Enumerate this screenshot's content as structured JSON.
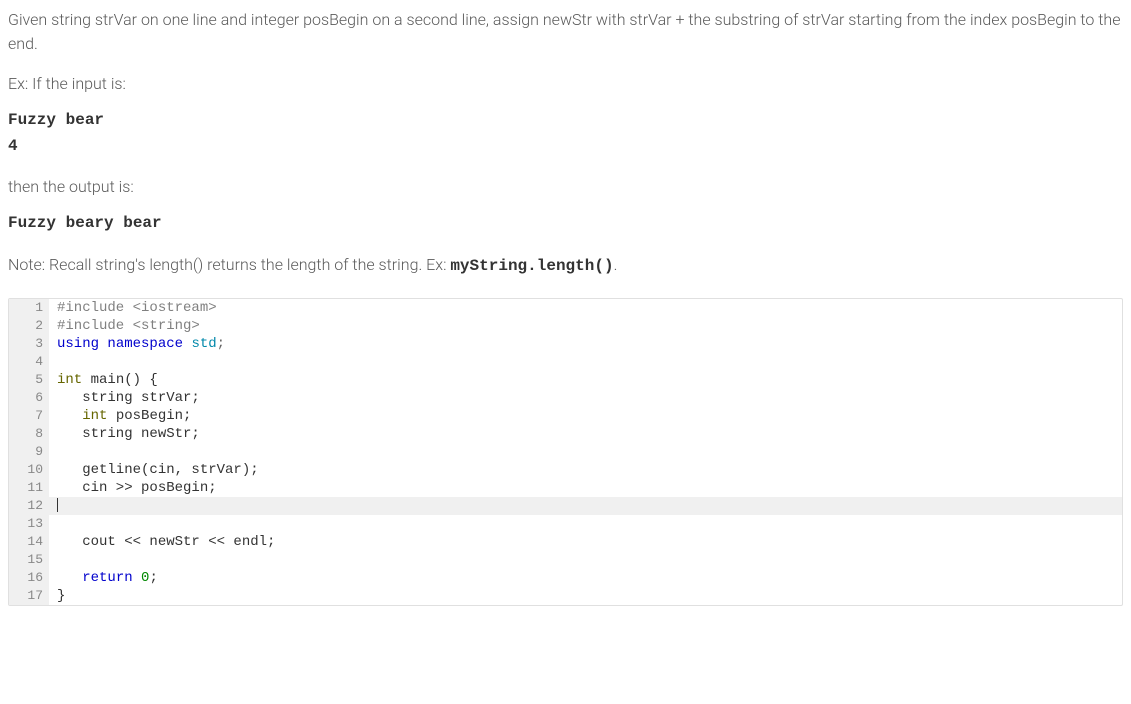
{
  "problem": {
    "description": "Given string strVar on one line and integer posBegin on a second line, assign newStr with strVar + the substring of strVar starting from the index posBegin to the end.",
    "example_intro": "Ex: If the input is:",
    "example_input": "Fuzzy bear\n4",
    "then_label": "then the output is:",
    "example_output": "Fuzzy beary bear",
    "note_prefix": "Note: Recall string's length() returns the length of the string. Ex: ",
    "note_code": "myString.length()",
    "note_suffix": "."
  },
  "code": {
    "lines": [
      {
        "n": "1",
        "tokens": [
          {
            "t": "#include <iostream>",
            "c": "tok-pp"
          }
        ],
        "editable": false
      },
      {
        "n": "2",
        "tokens": [
          {
            "t": "#include <string>",
            "c": "tok-pp"
          }
        ],
        "editable": false
      },
      {
        "n": "3",
        "tokens": [
          {
            "t": "using",
            "c": "tok-kw"
          },
          {
            "t": " ",
            "c": ""
          },
          {
            "t": "namespace",
            "c": "tok-kw"
          },
          {
            "t": " ",
            "c": ""
          },
          {
            "t": "std",
            "c": "tok-ns"
          },
          {
            "t": ";",
            "c": "tok-punct"
          }
        ],
        "editable": false
      },
      {
        "n": "4",
        "tokens": [
          {
            "t": "",
            "c": ""
          }
        ],
        "editable": false
      },
      {
        "n": "5",
        "tokens": [
          {
            "t": "int",
            "c": "tok-type"
          },
          {
            "t": " main() {",
            "c": ""
          }
        ],
        "editable": false
      },
      {
        "n": "6",
        "tokens": [
          {
            "t": "   string strVar;",
            "c": ""
          }
        ],
        "editable": false
      },
      {
        "n": "7",
        "tokens": [
          {
            "t": "   ",
            "c": ""
          },
          {
            "t": "int",
            "c": "tok-type"
          },
          {
            "t": " posBegin;",
            "c": ""
          }
        ],
        "editable": false
      },
      {
        "n": "8",
        "tokens": [
          {
            "t": "   string newStr;",
            "c": ""
          }
        ],
        "editable": false
      },
      {
        "n": "9",
        "tokens": [
          {
            "t": "",
            "c": ""
          }
        ],
        "editable": false
      },
      {
        "n": "10",
        "tokens": [
          {
            "t": "   getline(cin, strVar);",
            "c": ""
          }
        ],
        "editable": false
      },
      {
        "n": "11",
        "tokens": [
          {
            "t": "   cin >> posBegin;",
            "c": ""
          }
        ],
        "editable": false
      },
      {
        "n": "12",
        "tokens": [
          {
            "t": "",
            "c": ""
          }
        ],
        "editable": true,
        "cursor": true
      },
      {
        "n": "13",
        "tokens": [
          {
            "t": "",
            "c": ""
          }
        ],
        "editable": false
      },
      {
        "n": "14",
        "tokens": [
          {
            "t": "   cout << newStr << endl;",
            "c": ""
          }
        ],
        "editable": false
      },
      {
        "n": "15",
        "tokens": [
          {
            "t": "",
            "c": ""
          }
        ],
        "editable": false
      },
      {
        "n": "16",
        "tokens": [
          {
            "t": "   ",
            "c": ""
          },
          {
            "t": "return",
            "c": "tok-kw"
          },
          {
            "t": " ",
            "c": ""
          },
          {
            "t": "0",
            "c": "tok-num"
          },
          {
            "t": ";",
            "c": ""
          }
        ],
        "editable": false
      },
      {
        "n": "17",
        "tokens": [
          {
            "t": "}",
            "c": ""
          }
        ],
        "editable": false
      }
    ]
  }
}
